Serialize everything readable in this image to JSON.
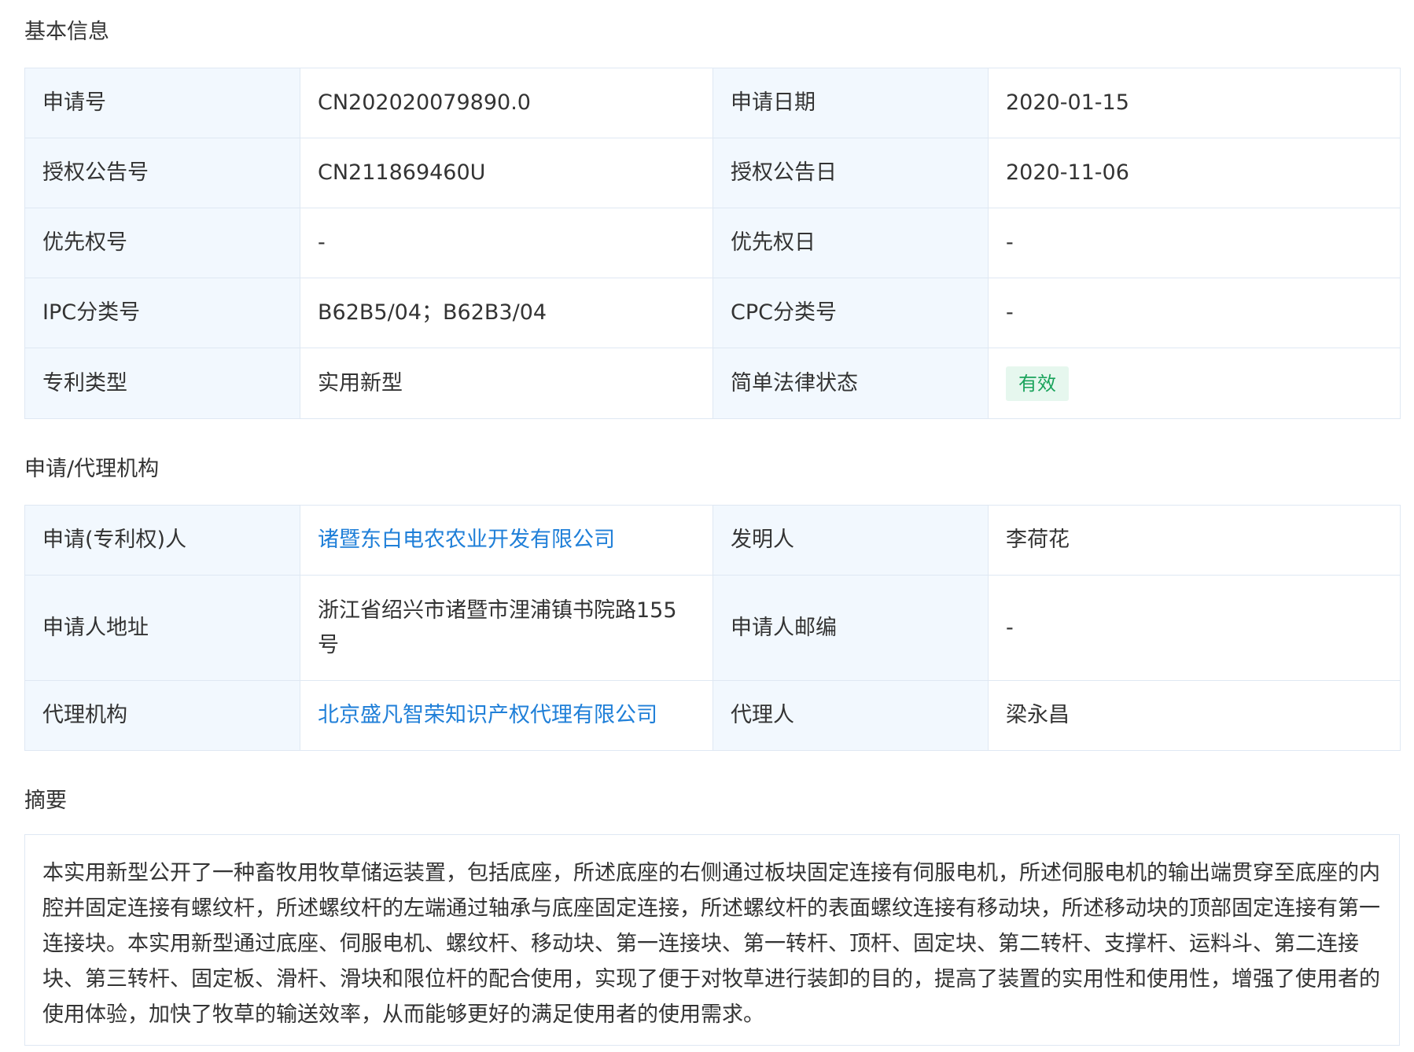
{
  "basic": {
    "title": "基本信息",
    "rows": [
      {
        "k1": "申请号",
        "v1": "CN202020079890.0",
        "k2": "申请日期",
        "v2": "2020-01-15"
      },
      {
        "k1": "授权公告号",
        "v1": "CN211869460U",
        "k2": "授权公告日",
        "v2": "2020-11-06"
      },
      {
        "k1": "优先权号",
        "v1": "-",
        "k2": "优先权日",
        "v2": "-"
      },
      {
        "k1": "IPC分类号",
        "v1": "B62B5/04；B62B3/04",
        "k2": "CPC分类号",
        "v2": "-"
      },
      {
        "k1": "专利类型",
        "v1": "实用新型",
        "k2": "简单法律状态",
        "v2": "有效"
      }
    ]
  },
  "agency": {
    "title": "申请/代理机构",
    "rows": [
      {
        "k1": "申请(专利权)人",
        "v1": "诸暨东白电农农业开发有限公司",
        "k2": "发明人",
        "v2": "李荷花"
      },
      {
        "k1": "申请人地址",
        "v1": "浙江省绍兴市诸暨市浬浦镇书院路155号",
        "k2": "申请人邮编",
        "v2": "-"
      },
      {
        "k1": "代理机构",
        "v1": "北京盛凡智荣知识产权代理有限公司",
        "k2": "代理人",
        "v2": "梁永昌"
      }
    ]
  },
  "abstract": {
    "title": "摘要",
    "text": "本实用新型公开了一种畜牧用牧草储运装置，包括底座，所述底座的右侧通过板块固定连接有伺服电机，所述伺服电机的输出端贯穿至底座的内腔并固定连接有螺纹杆，所述螺纹杆的左端通过轴承与底座固定连接，所述螺纹杆的表面螺纹连接有移动块，所述移动块的顶部固定连接有第一连接块。本实用新型通过底座、伺服电机、螺纹杆、移动块、第一连接块、第一转杆、顶杆、固定块、第二转杆、支撑杆、运料斗、第二连接块、第三转杆、固定板、滑杆、滑块和限位杆的配合使用，实现了便于对牧草进行装卸的目的，提高了装置的实用性和使用性，增强了使用者的使用体验，加快了牧草的输送效率，从而能够更好的满足使用者的使用需求。"
  },
  "colors": {
    "label_bg": "#f2f8fe",
    "border": "#dfe8f3",
    "link": "#1f7fd8",
    "badge_bg": "#e6f7ee",
    "badge_text": "#19a35b"
  }
}
